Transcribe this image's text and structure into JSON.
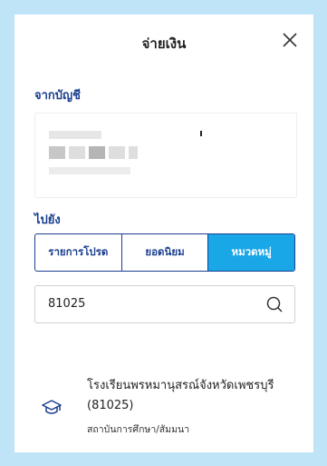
{
  "header": {
    "title": "จ่ายเงิน"
  },
  "from": {
    "label": "จากบัญชี"
  },
  "to": {
    "label": "ไปยัง"
  },
  "tabs": [
    {
      "label": "รายการโปรด",
      "active": false
    },
    {
      "label": "ยอดนิยม",
      "active": false
    },
    {
      "label": "หมวดหมู่",
      "active": true
    }
  ],
  "search": {
    "value": "81025"
  },
  "result": {
    "name_line1": "โรงเรียนพรหมานุสรณ์จังหวัดเพชรบุรี",
    "name_line2": "(81025)",
    "category": "สถาบันการศึกษา/สัมมนา"
  },
  "colors": {
    "accent": "#1aa7e8",
    "primary": "#1a3f8f",
    "background": "#bfe3f7"
  },
  "icons": {
    "close": "close-icon",
    "search": "search-icon",
    "education": "graduation-cap-icon"
  }
}
